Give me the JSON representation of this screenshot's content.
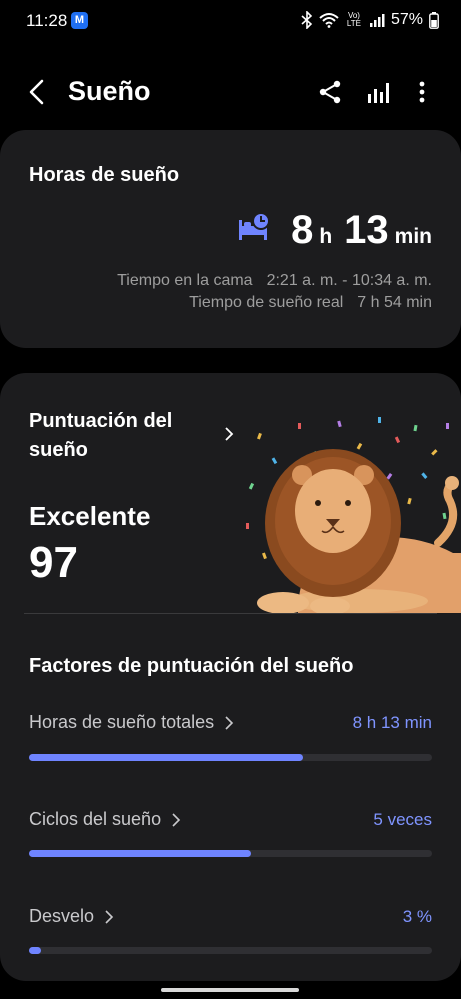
{
  "status": {
    "time": "11:28",
    "app_badge": "M",
    "volte": "Vo) LTE",
    "battery": "57%",
    "icons": [
      "bluetooth-icon",
      "wifi-icon",
      "signal-icon",
      "battery-icon"
    ]
  },
  "header": {
    "title": "Sueño",
    "icons": [
      "back-icon",
      "share-icon",
      "chart-icon",
      "more-icon"
    ]
  },
  "sleep_hours": {
    "title": "Horas de sueño",
    "hours": "8",
    "hours_unit": "h",
    "minutes": "13",
    "minutes_unit": "min",
    "time_in_bed_label": "Tiempo en la cama",
    "time_in_bed_value": "2:21 a. m. - 10:34 a. m.",
    "actual_sleep_label": "Tiempo de sueño real",
    "actual_sleep_value": "7 h 54 min"
  },
  "score": {
    "title": "Puntuación del sueño",
    "rating": "Excelente",
    "value": "97"
  },
  "factors": {
    "title": "Factores de puntuación del sueño",
    "items": [
      {
        "label": "Horas de sueño totales",
        "value": "8 h 13 min",
        "level": 0.68
      },
      {
        "label": "Ciclos del sueño",
        "value": "5 veces",
        "level": 0.55
      },
      {
        "label": "Desvelo",
        "value": "3 %",
        "level": 0.03
      }
    ]
  },
  "colors": {
    "accent": "#6f84ff",
    "card": "#1c1c1e",
    "background": "#000000"
  }
}
